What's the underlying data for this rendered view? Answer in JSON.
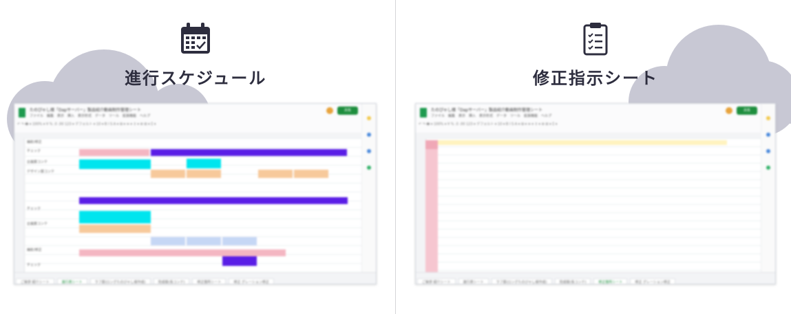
{
  "left": {
    "title": "進行スケジュール",
    "icon": "calendar-icon",
    "sheet_title": "たのぴゃし様「Dapサーバー」製品紹介動画制作管理シート",
    "tabs": [
      "ご挨拶 紹介シート",
      "進行表シート",
      "ラフ案(ロングたのびゃし様作成)",
      "完成版(長コンテ)",
      "修正箇所シート",
      "修正 グレーション修正"
    ],
    "active_tab": 1,
    "share_label": "共有"
  },
  "right": {
    "title": "修正指示シート",
    "icon": "clipboard-checklist-icon",
    "sheet_title": "たのぴゃし様「Dapサーバー」製品紹介動画制作管理シート",
    "tabs": [
      "ご挨拶 紹介シート",
      "進行表シート",
      "ラフ案(ロングたのびゃし様作成)",
      "完成版(長コンテ)",
      "修正箇所シート",
      "修正 グレーション修正"
    ],
    "active_tab": 4,
    "share_label": "共有"
  },
  "colors": {
    "cloud": "#c8c8d4",
    "title_text": "#2d2d3e",
    "icon": "#2d2d3e",
    "sheets_green": "#1e9a4f",
    "cyan": "#00e5ee",
    "purple": "#5a1ee6",
    "peach": "#f7c99b",
    "pink": "#f4b6c2",
    "light_blue": "#c6d7f5",
    "yellow": "#fff3bf"
  }
}
